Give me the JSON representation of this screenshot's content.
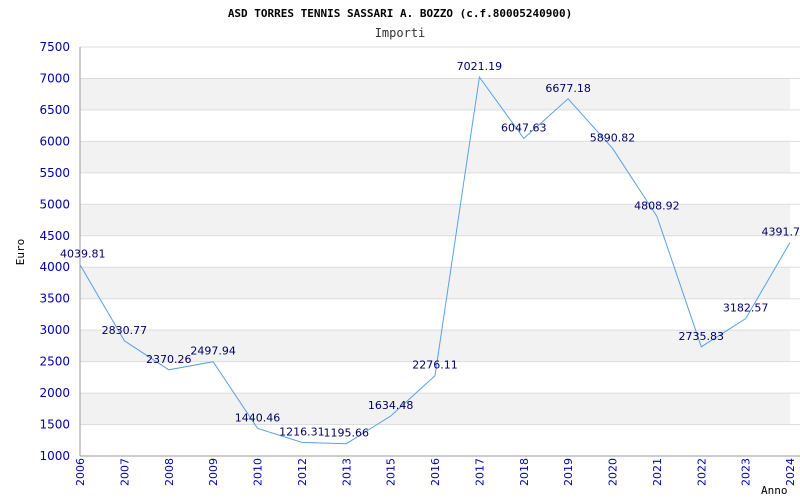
{
  "colors": {
    "line": "#5aa0e6",
    "band": "#f2f2f2",
    "grid": "#dddddd",
    "tick_text": "#0000aa",
    "label_text": "#000066"
  },
  "chart_data": {
    "type": "line",
    "title": "ASD TORRES TENNIS SASSARI A. BOZZO (c.f.80005240900)",
    "subtitle": "Importi",
    "xlabel": "Anno",
    "ylabel": "Euro",
    "ylim": [
      1000,
      7500
    ],
    "yticks": [
      1000,
      1500,
      2000,
      2500,
      3000,
      3500,
      4000,
      4500,
      5000,
      5500,
      6000,
      6500,
      7000,
      7500
    ],
    "grid": true,
    "categories": [
      "2006",
      "2007",
      "2008",
      "2009",
      "2010",
      "2012",
      "2013",
      "2015",
      "2016",
      "2017",
      "2018",
      "2019",
      "2020",
      "2021",
      "2022",
      "2023",
      "2024"
    ],
    "series": [
      {
        "values": [
          4039.81,
          2830.77,
          2370.26,
          2497.94,
          1440.46,
          1216.31,
          1195.66,
          1634.48,
          2276.11,
          7021.19,
          6047.63,
          6677.18,
          5890.82,
          4808.92,
          2735.83,
          3182.57,
          4391.7
        ],
        "labels": [
          "4039.81",
          "2830.77",
          "2370.26",
          "2497.94",
          "1440.46",
          "1216.31",
          "1195.66",
          "1634.48",
          "2276.11",
          "7021.19",
          "6047.63",
          "6677.18",
          "5890.82",
          "4808.92",
          "2735.83",
          "3182.57",
          "4391.7"
        ]
      }
    ]
  }
}
